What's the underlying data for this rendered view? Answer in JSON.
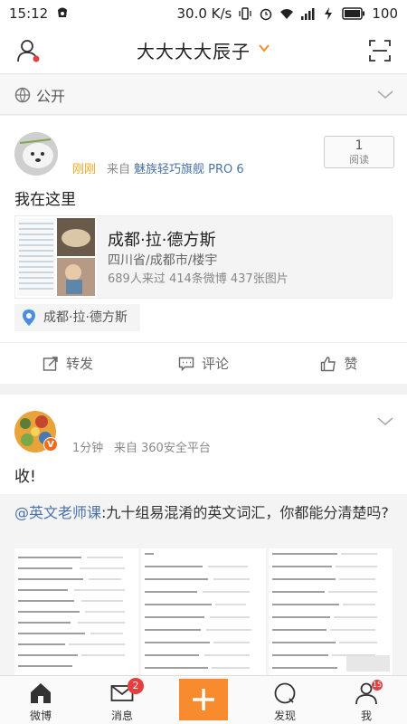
{
  "status_bar": {
    "time": "15:12",
    "speed": "30.0 K/s",
    "battery": "100"
  },
  "header": {
    "title": "大大大大辰子"
  },
  "visibility": {
    "label": "公开"
  },
  "post1": {
    "time": "刚刚",
    "source_prefix": "来自",
    "source": "魅族轻巧旗舰 PRO 6",
    "read_count": "1",
    "read_label": "阅读",
    "text": "我在这里",
    "place": {
      "name": "成都·拉·德方斯",
      "address": "四川省/成都市/楼宇",
      "stats": "689人来过 414条微博 437张图片"
    },
    "location_tag": "成都·拉·德方斯",
    "actions": {
      "repost": "转发",
      "comment": "评论",
      "like": "赞"
    }
  },
  "post2": {
    "time": "1分钟",
    "source_prefix": "来自",
    "source": "360安全平台",
    "verified": "V",
    "text": "收!",
    "repost": {
      "mention": "@英文老师课",
      "text": ":九十组易混淆的英文词汇，你都能分清楚吗?"
    }
  },
  "tabbar": {
    "tabs": [
      {
        "label": "微博"
      },
      {
        "label": "消息",
        "badge": "2"
      },
      {
        "label": ""
      },
      {
        "label": "发现"
      },
      {
        "label": "我",
        "badge": "15"
      }
    ]
  },
  "colors": {
    "accent": "#f78b2d",
    "link": "#4a72a8",
    "badge": "#e43f3f"
  }
}
